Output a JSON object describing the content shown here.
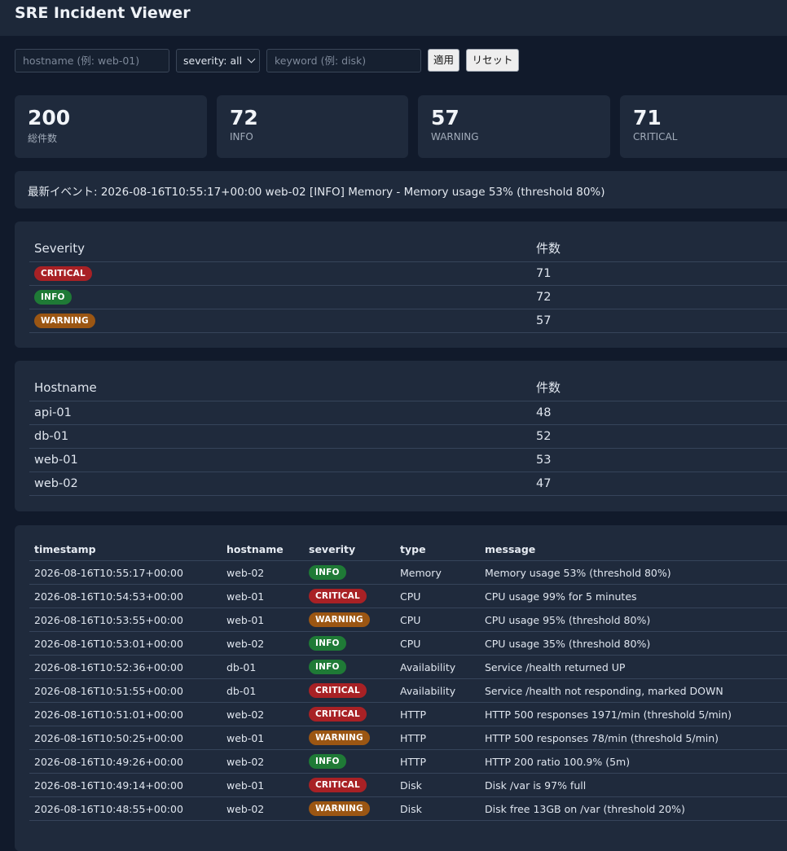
{
  "app": {
    "title": "SRE Incident Viewer"
  },
  "filters": {
    "hostname_placeholder": "hostname (例: web-01)",
    "severity_selected": "severity: all",
    "keyword_placeholder": "keyword (例: disk)",
    "apply_label": "適用",
    "reset_label": "リセット"
  },
  "stats": [
    {
      "value": "200",
      "label": "総件数"
    },
    {
      "value": "72",
      "label": "INFO"
    },
    {
      "value": "57",
      "label": "WARNING"
    },
    {
      "value": "71",
      "label": "CRITICAL"
    }
  ],
  "latest": {
    "text": "最新イベント: 2026-08-16T10:55:17+00:00 web-02 [INFO] Memory - Memory usage 53% (threshold 80%)"
  },
  "severity_summary": {
    "headers": [
      "Severity",
      "件数"
    ],
    "rows": [
      {
        "severity": "CRITICAL",
        "count": "71"
      },
      {
        "severity": "INFO",
        "count": "72"
      },
      {
        "severity": "WARNING",
        "count": "57"
      }
    ]
  },
  "hostname_summary": {
    "headers": [
      "Hostname",
      "件数"
    ],
    "rows": [
      {
        "hostname": "api-01",
        "count": "48"
      },
      {
        "hostname": "db-01",
        "count": "52"
      },
      {
        "hostname": "web-01",
        "count": "53"
      },
      {
        "hostname": "web-02",
        "count": "47"
      }
    ]
  },
  "events": {
    "headers": [
      "timestamp",
      "hostname",
      "severity",
      "type",
      "message"
    ],
    "rows": [
      {
        "timestamp": "2026-08-16T10:55:17+00:00",
        "hostname": "web-02",
        "severity": "INFO",
        "type": "Memory",
        "message": "Memory usage 53% (threshold 80%)"
      },
      {
        "timestamp": "2026-08-16T10:54:53+00:00",
        "hostname": "web-01",
        "severity": "CRITICAL",
        "type": "CPU",
        "message": "CPU usage 99% for 5 minutes"
      },
      {
        "timestamp": "2026-08-16T10:53:55+00:00",
        "hostname": "web-01",
        "severity": "WARNING",
        "type": "CPU",
        "message": "CPU usage 95% (threshold 80%)"
      },
      {
        "timestamp": "2026-08-16T10:53:01+00:00",
        "hostname": "web-02",
        "severity": "INFO",
        "type": "CPU",
        "message": "CPU usage 35% (threshold 80%)"
      },
      {
        "timestamp": "2026-08-16T10:52:36+00:00",
        "hostname": "db-01",
        "severity": "INFO",
        "type": "Availability",
        "message": "Service /health returned UP"
      },
      {
        "timestamp": "2026-08-16T10:51:55+00:00",
        "hostname": "db-01",
        "severity": "CRITICAL",
        "type": "Availability",
        "message": "Service /health not responding, marked DOWN"
      },
      {
        "timestamp": "2026-08-16T10:51:01+00:00",
        "hostname": "web-02",
        "severity": "CRITICAL",
        "type": "HTTP",
        "message": "HTTP 500 responses 1971/min (threshold 5/min)"
      },
      {
        "timestamp": "2026-08-16T10:50:25+00:00",
        "hostname": "web-01",
        "severity": "WARNING",
        "type": "HTTP",
        "message": "HTTP 500 responses 78/min (threshold 5/min)"
      },
      {
        "timestamp": "2026-08-16T10:49:26+00:00",
        "hostname": "web-02",
        "severity": "INFO",
        "type": "HTTP",
        "message": "HTTP 200 ratio 100.9% (5m)"
      },
      {
        "timestamp": "2026-08-16T10:49:14+00:00",
        "hostname": "web-01",
        "severity": "CRITICAL",
        "type": "Disk",
        "message": "Disk /var is 97% full"
      },
      {
        "timestamp": "2026-08-16T10:48:55+00:00",
        "hostname": "web-02",
        "severity": "WARNING",
        "type": "Disk",
        "message": "Disk free 13GB on /var (threshold 20%)"
      }
    ]
  },
  "colors": {
    "critical": "#a82125",
    "info": "#1f7a36",
    "warning": "#9b5613"
  }
}
